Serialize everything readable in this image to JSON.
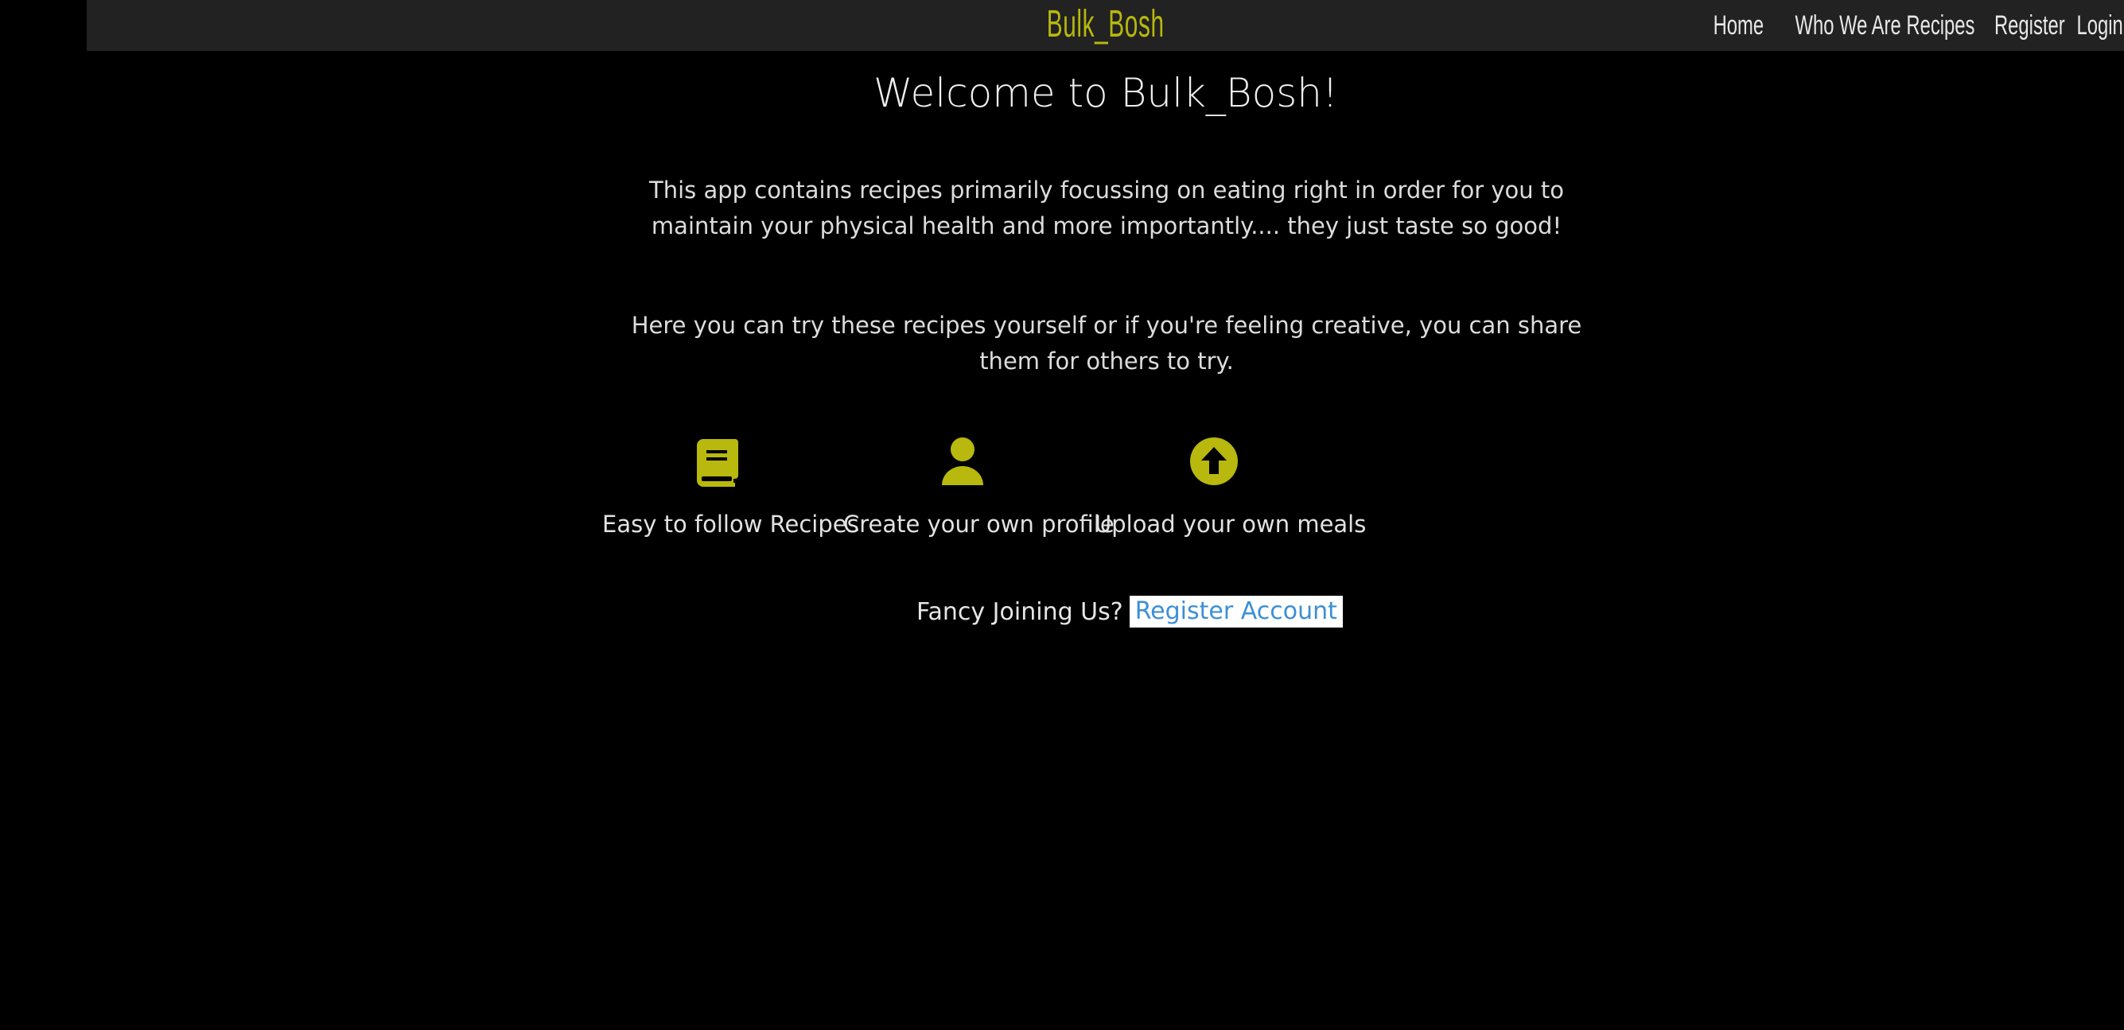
{
  "nav": {
    "brand": "Bulk_Bosh",
    "links": [
      "Home",
      "Who We Are",
      "Recipes",
      "Register",
      "Login"
    ]
  },
  "main": {
    "title": "Welcome to Bulk_Bosh!",
    "intro": "This app contains recipes primarily focussing on eating right in order for you to maintain your physical health and more importantly.... they just taste so good!",
    "sub": "Here you can try these recipes yourself or if you're feeling creative, you can share them for others to try.",
    "features": [
      {
        "label": "Easy to follow Recipes",
        "icon": "book-icon"
      },
      {
        "label": "Create your own profile",
        "icon": "user-icon"
      },
      {
        "label": "Upload your own meals",
        "icon": "upload-icon"
      }
    ],
    "cta_text": "Fancy Joining Us?",
    "cta_button": "Register Account"
  },
  "colors": {
    "accent": "#b8b80e",
    "navbar": "#222222",
    "background": "#000000",
    "link": "#3d8fd6"
  }
}
